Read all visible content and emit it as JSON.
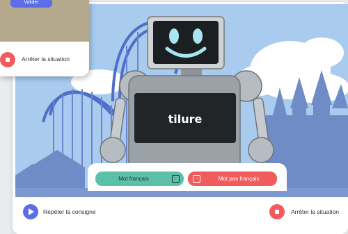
{
  "front_card": {
    "validate_label": "Valider",
    "stop_label": "Arrêter la situation"
  },
  "screen": {
    "word": "tilure"
  },
  "answers": {
    "french_label": "Mot français",
    "not_french_label": "Mot pas français"
  },
  "toolbar": {
    "repeat_label": "Répéter la consigne",
    "stop_label": "Arrêter la situation"
  },
  "colors": {
    "sky": "#a8cbee",
    "primary": "#5b6ee8",
    "green": "#5bc0a7",
    "red": "#f25b5b"
  },
  "icons": {
    "french_button": "arrow-left-box-icon",
    "not_french_button": "arrow-right-box-icon",
    "play": "play-icon",
    "stop": "stop-icon"
  }
}
